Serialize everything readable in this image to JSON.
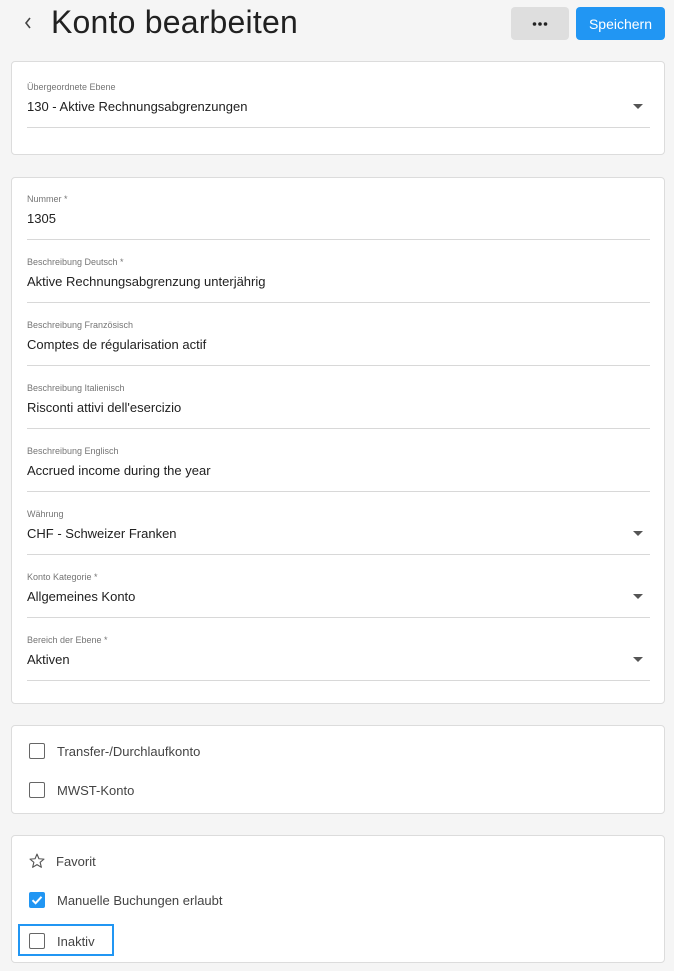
{
  "header": {
    "title": "Konto bearbeiten",
    "more_label": "•••",
    "save_label": "Speichern"
  },
  "parent_card": {
    "parent_level": {
      "label": "Übergeordnete Ebene",
      "value": "130 - Aktive Rechnungsabgrenzungen"
    }
  },
  "main_card": {
    "number": {
      "label": "Nummer *",
      "value": "1305"
    },
    "desc_de": {
      "label": "Beschreibung Deutsch *",
      "value": "Aktive Rechnungsabgrenzung unterjährig"
    },
    "desc_fr": {
      "label": "Beschreibung Französisch",
      "value": "Comptes de régularisation actif"
    },
    "desc_it": {
      "label": "Beschreibung Italienisch",
      "value": "Risconti attivi dell'esercizio"
    },
    "desc_en": {
      "label": "Beschreibung Englisch",
      "value": "Accrued income during the year"
    },
    "currency": {
      "label": "Währung",
      "value": "CHF - Schweizer Franken"
    },
    "category": {
      "label": "Konto Kategorie *",
      "value": "Allgemeines Konto"
    },
    "level_area": {
      "label": "Bereich der Ebene *",
      "value": "Aktiven"
    }
  },
  "options_card": {
    "transfer": {
      "label": "Transfer-/Durchlaufkonto",
      "checked": false
    },
    "vat": {
      "label": "MWST-Konto",
      "checked": false
    }
  },
  "flags_card": {
    "favorite": {
      "label": "Favorit"
    },
    "manual_bookings": {
      "label": "Manuelle Buchungen erlaubt",
      "checked": true
    },
    "inactive": {
      "label": "Inaktiv",
      "checked": false
    }
  },
  "colors": {
    "accent": "#2196f3",
    "background": "#f5f5f5",
    "card": "#ffffff"
  }
}
